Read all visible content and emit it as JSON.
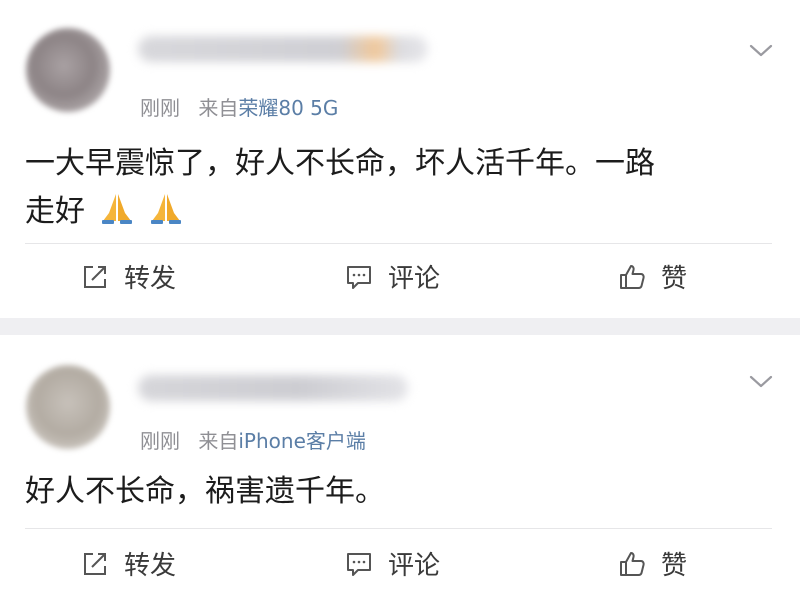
{
  "posts": [
    {
      "time": "刚刚",
      "from_label": "来自",
      "source": "荣耀80 5G",
      "content_line1": "一大早震惊了，好人不长命，坏人活千年。一路",
      "content_line2": "走好",
      "emoji": "folded-hands",
      "actions": {
        "repost": "转发",
        "comment": "评论",
        "like": "赞"
      }
    },
    {
      "time": "刚刚",
      "from_label": "来自",
      "source": "iPhone客户端",
      "content_line1": "好人不长命，祸害遗千年。",
      "actions": {
        "repost": "转发",
        "comment": "评论",
        "like": "赞"
      }
    }
  ],
  "colors": {
    "source_link": "#5b7ea6",
    "meta_gray": "#8f8f94",
    "separator": "#efeff2"
  }
}
